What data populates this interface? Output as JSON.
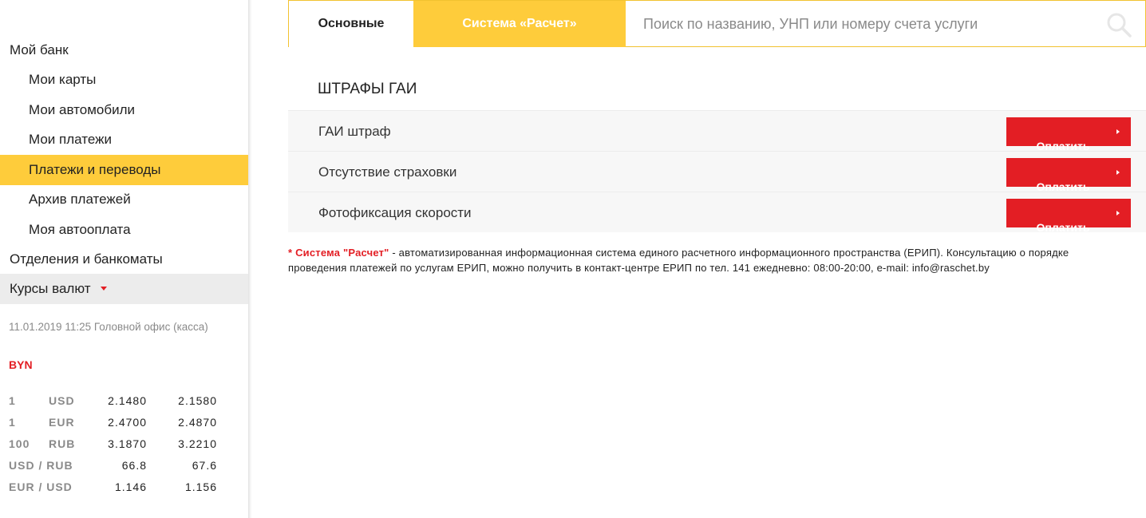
{
  "sidebar": {
    "my_bank": "Мой банк",
    "items": [
      {
        "label": "Мои карты"
      },
      {
        "label": "Мои автомобили"
      },
      {
        "label": "Мои платежи"
      },
      {
        "label": "Платежи и переводы"
      },
      {
        "label": "Архив платежей"
      },
      {
        "label": "Моя автооплата"
      }
    ],
    "branches": "Отделения и банкоматы",
    "currency_rates": "Курсы валют"
  },
  "rates": {
    "date": "11.01.2019 11:25 Головной офис (касса)",
    "base": "BYN",
    "rows": [
      {
        "qty": "1",
        "cur": "USD",
        "buy": "2.1480",
        "sell": "2.1580"
      },
      {
        "qty": "1",
        "cur": "EUR",
        "buy": "2.4700",
        "sell": "2.4870"
      },
      {
        "qty": "100",
        "cur": "RUB",
        "buy": "3.1870",
        "sell": "3.2210"
      }
    ],
    "pairs": [
      {
        "pair": "USD / RUB",
        "buy": "66.8",
        "sell": "67.6"
      },
      {
        "pair": "EUR / USD",
        "buy": "1.146",
        "sell": "1.156"
      }
    ]
  },
  "topbar": {
    "tab_main": "Основные",
    "tab_raschet": "Система «Расчет»",
    "search_placeholder": "Поиск по названию, УНП или номеру счета услуги"
  },
  "section": {
    "title": "ШТРАФЫ ГАИ",
    "services": [
      {
        "name": "ГАИ штраф",
        "button": "Оплатить"
      },
      {
        "name": "Отсутствие страховки",
        "button": "Оплатить"
      },
      {
        "name": "Фотофиксация скорости",
        "button": "Оплатить"
      }
    ]
  },
  "footnote": {
    "star": "*",
    "brand": "Система \"Расчет\"",
    "text": " - автоматизированная информационная система единого расчетного информационного пространства (ЕРИП). Консультацию о порядке проведения платежей по услугам ЕРИП, можно получить в контакт-центре ЕРИП по тел. 141 ежедневно: 08:00-20:00, e-mail: info@raschet.by"
  },
  "colors": {
    "accent_yellow": "#fecc3b",
    "accent_red": "#e31e24"
  }
}
